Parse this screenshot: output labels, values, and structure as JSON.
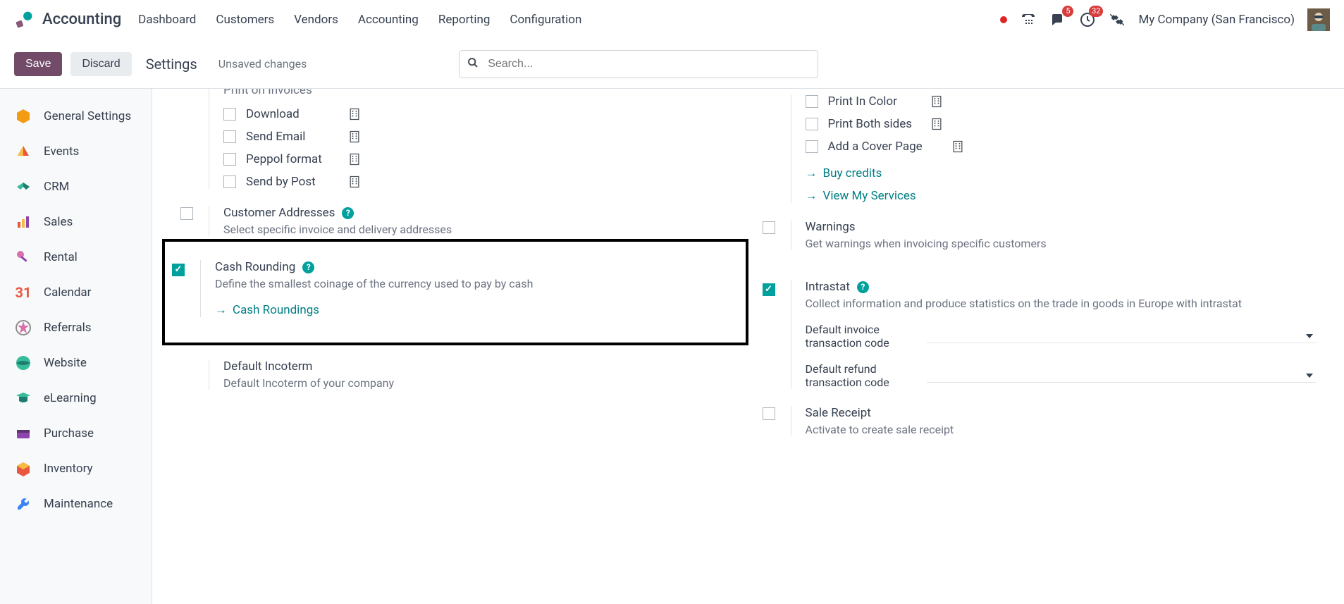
{
  "header": {
    "app_name": "Accounting",
    "menu": [
      "Dashboard",
      "Customers",
      "Vendors",
      "Accounting",
      "Reporting",
      "Configuration"
    ],
    "company": "My Company (San Francisco)",
    "msg_badge": "5",
    "activity_badge": "32"
  },
  "controls": {
    "save": "Save",
    "discard": "Discard",
    "breadcrumb": "Settings",
    "unsaved": "Unsaved changes",
    "search_placeholder": "Search..."
  },
  "sidebar": {
    "items": [
      {
        "label": "General Settings"
      },
      {
        "label": "Events"
      },
      {
        "label": "CRM"
      },
      {
        "label": "Sales"
      },
      {
        "label": "Rental"
      },
      {
        "label": "Calendar"
      },
      {
        "label": "Referrals"
      },
      {
        "label": "Website"
      },
      {
        "label": "eLearning"
      },
      {
        "label": "Purchase"
      },
      {
        "label": "Inventory"
      },
      {
        "label": "Maintenance"
      }
    ]
  },
  "left_col": {
    "partial_heading": "Print  on Invoices",
    "send_print": {
      "download": "Download",
      "send_email": "Send Email",
      "peppol": "Peppol format",
      "send_post": "Send by Post"
    },
    "cust_addr": {
      "title": "Customer Addresses",
      "desc": "Select specific invoice and delivery addresses"
    },
    "cash_rounding": {
      "title": "Cash Rounding",
      "desc": "Define the smallest coinage of the currency used to pay by cash",
      "link": "Cash Roundings"
    },
    "default_incoterm": {
      "title": "Default Incoterm",
      "desc": "Default Incoterm of your company"
    }
  },
  "right_col": {
    "print_opts": {
      "color": "Print In Color",
      "both": "Print Both sides",
      "cover": "Add a Cover Page",
      "buy": "Buy credits",
      "view": "View My Services"
    },
    "warnings": {
      "title": "Warnings",
      "desc": "Get warnings when invoicing specific customers"
    },
    "intrastat": {
      "title": "Intrastat",
      "desc": "Collect information and produce statistics on the trade in goods in Europe with intrastat",
      "invoice_code": "Default invoice transaction code",
      "refund_code": "Default refund transaction code"
    },
    "sale_receipt": {
      "title": "Sale Receipt",
      "desc": "Activate to create sale receipt"
    }
  }
}
